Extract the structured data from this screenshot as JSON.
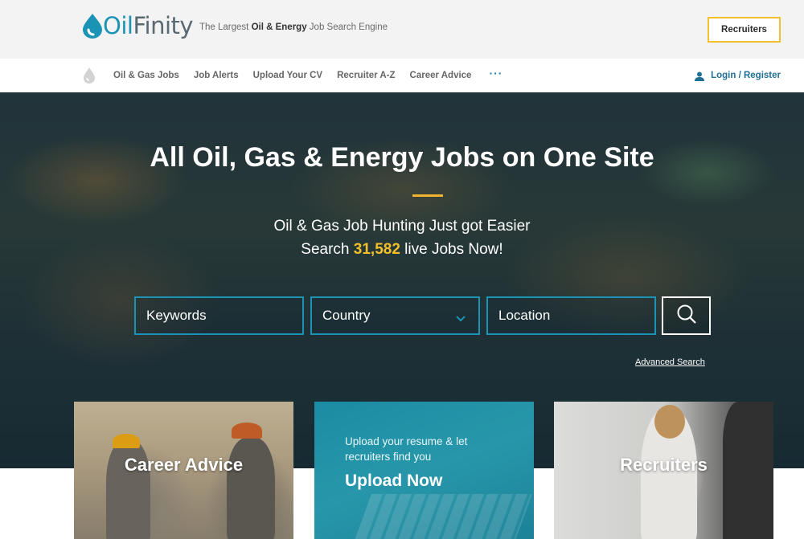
{
  "header": {
    "logo_oil": "Oil",
    "logo_finity": "Finity",
    "tagline_pre": "The Largest ",
    "tagline_bold": "Oil & Energy",
    "tagline_post": " Job Search Engine",
    "recruiters_button": "Recruiters",
    "accent_color": "#1b93b5",
    "highlight_color": "#f3bf2a"
  },
  "nav": {
    "items": [
      {
        "label": "Oil & Gas Jobs"
      },
      {
        "label": "Job Alerts"
      },
      {
        "label": "Upload Your CV"
      },
      {
        "label": "Recruiter A-Z"
      },
      {
        "label": "Career Advice"
      }
    ],
    "more": "···",
    "login": "Login / Register"
  },
  "hero": {
    "title": "All Oil, Gas & Energy Jobs on One Site",
    "subtitle": "Oil & Gas Job Hunting Just got Easier",
    "search_pre": "Search ",
    "job_count": "31,582",
    "search_post": " live Jobs Now!",
    "keywords_placeholder": "Keywords",
    "country_value": "Country",
    "location_placeholder": "Location",
    "advanced_search": "Advanced Search"
  },
  "cards": {
    "career": {
      "title": "Career Advice"
    },
    "upload": {
      "text": "Upload your resume & let recruiters find you",
      "title": "Upload Now"
    },
    "recruiters": {
      "title": "Recruiters"
    }
  },
  "icons": {
    "logo": "oil-drop-logo-icon",
    "nav_home": "drop-icon",
    "login": "user-icon",
    "country_toggle": "chevron-down-icon",
    "search": "search-icon"
  }
}
